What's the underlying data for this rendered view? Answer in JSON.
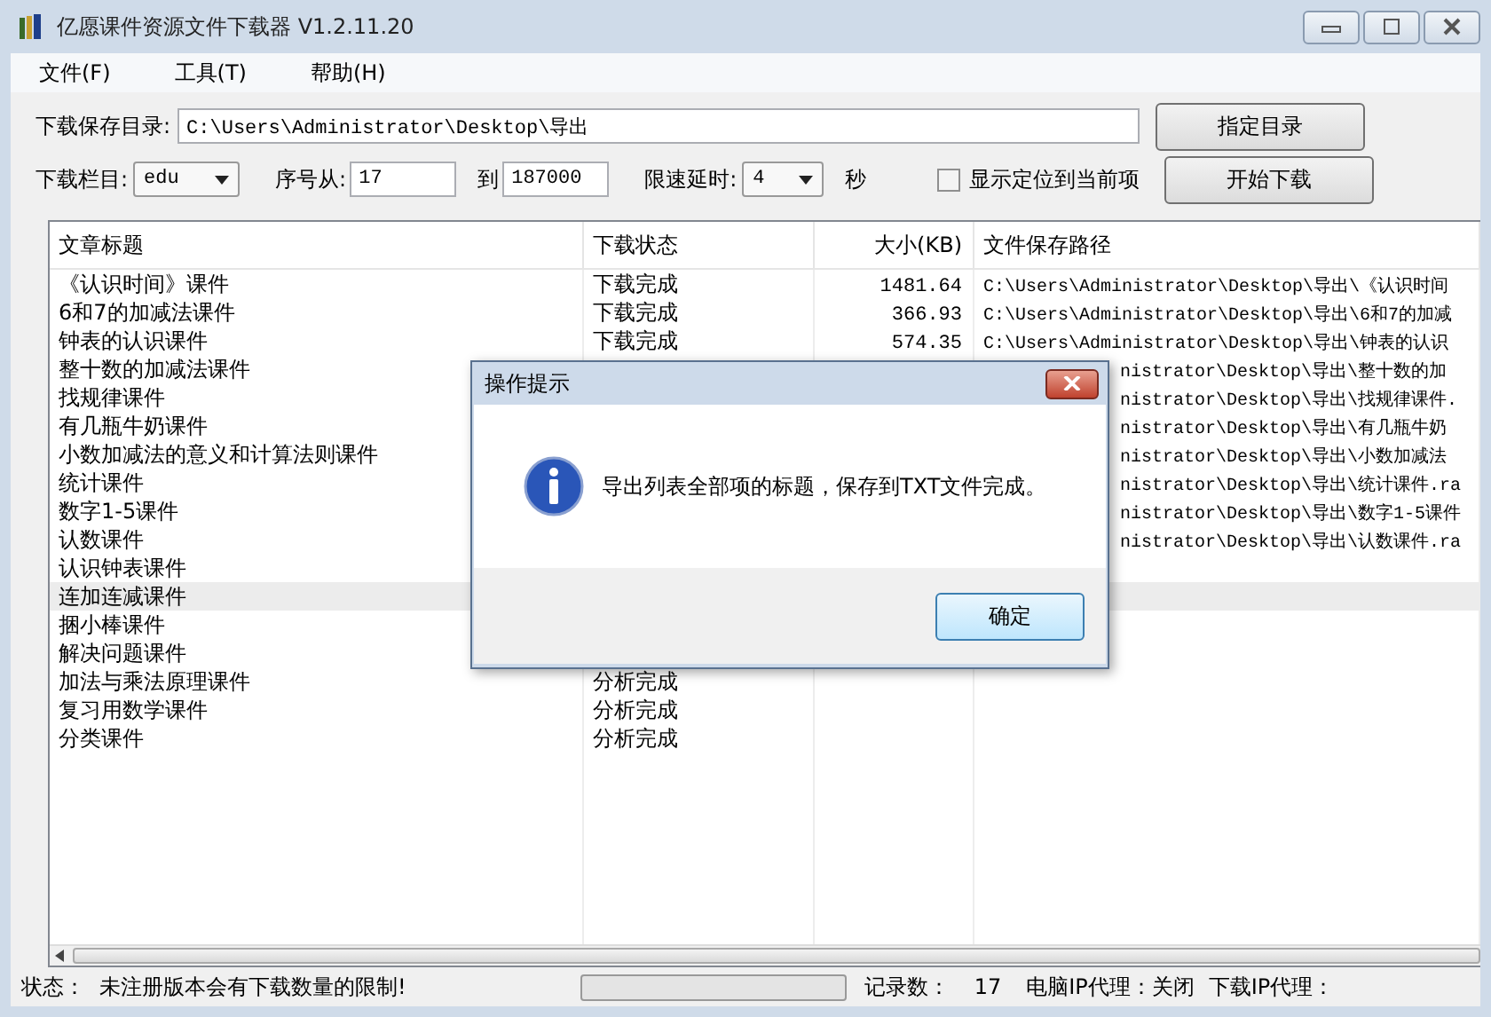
{
  "window": {
    "title": "亿愿课件资源文件下载器 V1.2.11.20"
  },
  "menu": [
    "文件(F)",
    "工具(T)",
    "帮助(H)"
  ],
  "save_dir": {
    "label": "下载保存目录:",
    "value": "C:\\Users\\Administrator\\Desktop\\导出",
    "button": "指定目录"
  },
  "options": {
    "column_label": "下载栏目:",
    "column_value": "edu",
    "from_label": "序号从:",
    "from_value": "17",
    "to_label": "到",
    "to_value": "187000",
    "delay_label": "限速延时:",
    "delay_value": "4",
    "delay_unit": "秒",
    "locate": {
      "label": "显示定位到当前项",
      "checked": false
    },
    "start_button": "开始下载"
  },
  "table": {
    "columns": [
      "文章标题",
      "下载状态",
      "大小(KB)",
      "文件保存路径"
    ],
    "rows": [
      {
        "title": "《认识时间》课件",
        "status": "下载完成",
        "size": "1481.64",
        "path": "C:\\Users\\Administrator\\Desktop\\导出\\《认识时间",
        "selected": false,
        "kind": "full"
      },
      {
        "title": "6和7的加减法课件",
        "status": "下载完成",
        "size": "366.93",
        "path": "C:\\Users\\Administrator\\Desktop\\导出\\6和7的加减",
        "selected": false,
        "kind": "full"
      },
      {
        "title": "钟表的认识课件",
        "status": "下载完成",
        "size": "574.35",
        "path": "C:\\Users\\Administrator\\Desktop\\导出\\钟表的认识",
        "selected": false,
        "kind": "full"
      },
      {
        "title": "整十数的加减法课件",
        "path": "nistrator\\Desktop\\导出\\整十数的加",
        "selected": false,
        "kind": "covered"
      },
      {
        "title": "找规律课件",
        "path": "nistrator\\Desktop\\导出\\找规律课件.",
        "selected": false,
        "kind": "covered"
      },
      {
        "title": "有几瓶牛奶课件",
        "path": "nistrator\\Desktop\\导出\\有几瓶牛奶",
        "selected": false,
        "kind": "covered"
      },
      {
        "title": "小数加减法的意义和计算法则课件",
        "path": "nistrator\\Desktop\\导出\\小数加减法",
        "selected": false,
        "kind": "covered"
      },
      {
        "title": "统计课件",
        "path": "nistrator\\Desktop\\导出\\统计课件.ra",
        "selected": false,
        "kind": "covered"
      },
      {
        "title": "数字1-5课件",
        "path": "nistrator\\Desktop\\导出\\数字1-5课件",
        "selected": false,
        "kind": "covered"
      },
      {
        "title": "认数课件",
        "path": "nistrator\\Desktop\\导出\\认数课件.ra",
        "selected": false,
        "kind": "covered"
      },
      {
        "title": "认识钟表课件",
        "selected": false,
        "kind": "covered"
      },
      {
        "title": "连加连减课件",
        "selected": true,
        "kind": "covered"
      },
      {
        "title": "捆小棒课件",
        "selected": false,
        "kind": "covered"
      },
      {
        "title": "解决问题课件",
        "selected": false,
        "kind": "covered"
      },
      {
        "title": "加法与乘法原理课件",
        "status": "分析完成",
        "selected": false,
        "kind": "full"
      },
      {
        "title": "复习用数学课件",
        "status": "分析完成",
        "selected": false,
        "kind": "full"
      },
      {
        "title": "分类课件",
        "status": "分析完成",
        "selected": false,
        "kind": "full"
      }
    ]
  },
  "dialog": {
    "title": "操作提示",
    "message": "导出列表全部项的标题，保存到TXT文件完成。",
    "button": "确定"
  },
  "status_bar": {
    "label": "状态：",
    "message": "未注册版本会有下载数量的限制!",
    "progress": {
      "level": 0
    },
    "count_label": "记录数：",
    "count": "17",
    "pc_proxy": "电脑IP代理：关闭",
    "dl_proxy": "下载IP代理："
  }
}
